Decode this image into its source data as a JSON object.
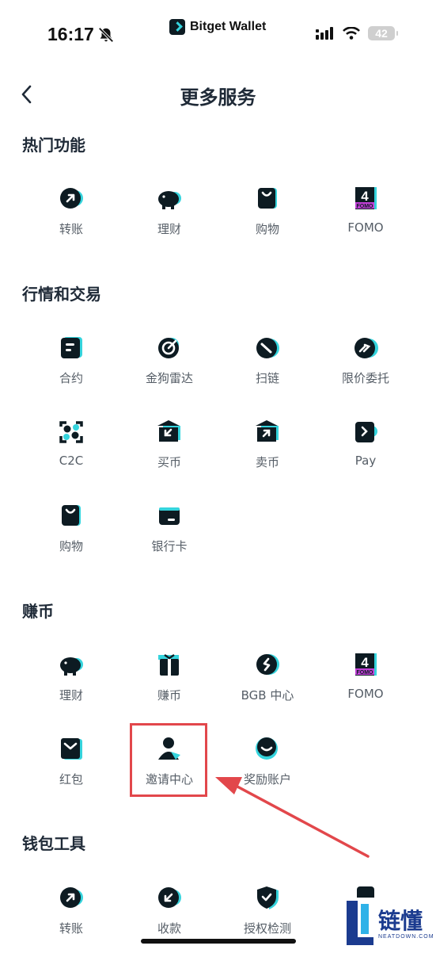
{
  "status_bar": {
    "time": "16:17",
    "brand": "Bitget Wallet",
    "battery": "42"
  },
  "header": {
    "title": "更多服务"
  },
  "sections": [
    {
      "title": "热门功能",
      "items": [
        {
          "label": "转账",
          "icon": "transfer-icon"
        },
        {
          "label": "理财",
          "icon": "piggy-bank-icon"
        },
        {
          "label": "购物",
          "icon": "shopping-bag-icon"
        },
        {
          "label": "FOMO",
          "icon": "fomo-icon"
        }
      ]
    },
    {
      "title": "行情和交易",
      "items": [
        {
          "label": "合约",
          "icon": "contract-icon"
        },
        {
          "label": "金狗雷达",
          "icon": "radar-icon"
        },
        {
          "label": "扫链",
          "icon": "scan-chain-icon"
        },
        {
          "label": "限价委托",
          "icon": "limit-order-icon"
        },
        {
          "label": "C2C",
          "icon": "c2c-icon"
        },
        {
          "label": "买币",
          "icon": "buy-crypto-icon"
        },
        {
          "label": "卖币",
          "icon": "sell-crypto-icon"
        },
        {
          "label": "Pay",
          "icon": "pay-icon"
        },
        {
          "label": "购物",
          "icon": "shopping-bag-icon"
        },
        {
          "label": "银行卡",
          "icon": "bank-card-icon"
        }
      ]
    },
    {
      "title": "赚币",
      "items": [
        {
          "label": "理财",
          "icon": "piggy-bank-icon"
        },
        {
          "label": "赚币",
          "icon": "gift-icon"
        },
        {
          "label": "BGB 中心",
          "icon": "bgb-icon"
        },
        {
          "label": "FOMO",
          "icon": "fomo-icon"
        },
        {
          "label": "红包",
          "icon": "red-packet-icon"
        },
        {
          "label": "邀请中心",
          "icon": "invite-icon"
        },
        {
          "label": "奖励账户",
          "icon": "reward-account-icon"
        }
      ]
    },
    {
      "title": "钱包工具",
      "items": [
        {
          "label": "转账",
          "icon": "transfer-icon"
        },
        {
          "label": "收款",
          "icon": "receive-icon"
        },
        {
          "label": "授权检测",
          "icon": "authorization-check-icon"
        }
      ]
    }
  ],
  "fomo_badge": {
    "number": "4",
    "text": "FOMO"
  },
  "watermark": {
    "main": "链懂",
    "sub": "NEATDOWN.COM"
  },
  "colors": {
    "icon": "#0d1b22",
    "accent": "#35d4dd",
    "highlight": "#e2474b",
    "fomo_magenta": "#c13fd6"
  }
}
